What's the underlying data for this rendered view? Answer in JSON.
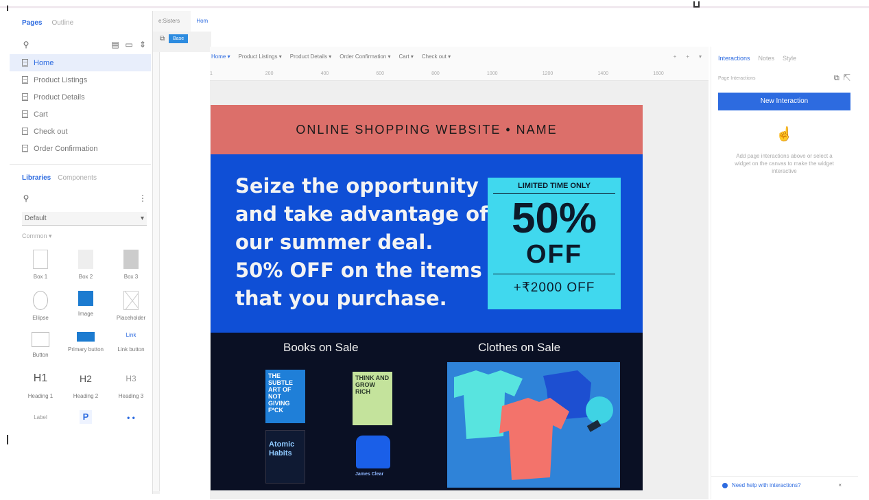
{
  "left_panel": {
    "tabs": [
      "Pages",
      "Outline"
    ],
    "pages": [
      "Home",
      "Product Listings",
      "Product Details",
      "Cart",
      "Check out",
      "Order Confirmation"
    ],
    "lib_tabs": [
      "Libraries",
      "Components"
    ],
    "library_select": "Default",
    "section": "Common ▾",
    "widgets": [
      "Box 1",
      "Box 2",
      "Box 3",
      "Ellipse",
      "Image",
      "Placeholder",
      "Button",
      "Primary button",
      "Link button",
      "Heading 1",
      "Heading 2",
      "Heading 3",
      "Label",
      "P",
      "• •"
    ],
    "link_button_text": "Link",
    "heading_glyphs": [
      "H1",
      "H2",
      "H3"
    ]
  },
  "strip": {
    "tabs": [
      "e:Sisters",
      "Hom"
    ],
    "badge": "Base"
  },
  "canvas": {
    "page_tabs": [
      "Home ▾",
      "Product Listings ▾",
      "Product Details ▾",
      "Order Confirmation ▾",
      "Cart ▾",
      "Check out ▾"
    ],
    "page_tab_icons": [
      "+",
      "+",
      "▾"
    ],
    "ruler": [
      "1",
      "200",
      "400",
      "600",
      "800",
      "1000",
      "1200",
      "1400",
      "1600"
    ]
  },
  "site": {
    "header": "ONLINE SHOPPING WEBSITE • NAME",
    "promo_lines": [
      "Seize the opportunity",
      "and take advantage of",
      "our summer deal.",
      "50% OFF on the items",
      "that you purchase."
    ],
    "offer_top": "LIMITED TIME ONLY",
    "offer_pct": "50%",
    "offer_off": "OFF",
    "offer_bottom": "+₹2000 OFF",
    "books_title": "Books on Sale",
    "clothes_title": "Clothes on Sale",
    "books": [
      {
        "text": "THE SUBTLE ART OF NOT GIVING F*CK",
        "color": "#1f7fd8"
      },
      {
        "text": "THINK AND GROW RICH",
        "color": "#c4e39c"
      },
      {
        "text": "Atomic Habits",
        "color": "#0f1a33"
      },
      {
        "text": "James Clear",
        "color": "#1a5fe8"
      }
    ]
  },
  "right_panel": {
    "tabs": [
      "Interactions",
      "Notes",
      "Style"
    ],
    "page_interactions": "Page Interactions",
    "new_interaction": "New Interaction",
    "hint": "Add page interactions above or select a widget on the canvas to make the widget interactive",
    "help": "Need help with interactions?",
    "close": "×"
  }
}
